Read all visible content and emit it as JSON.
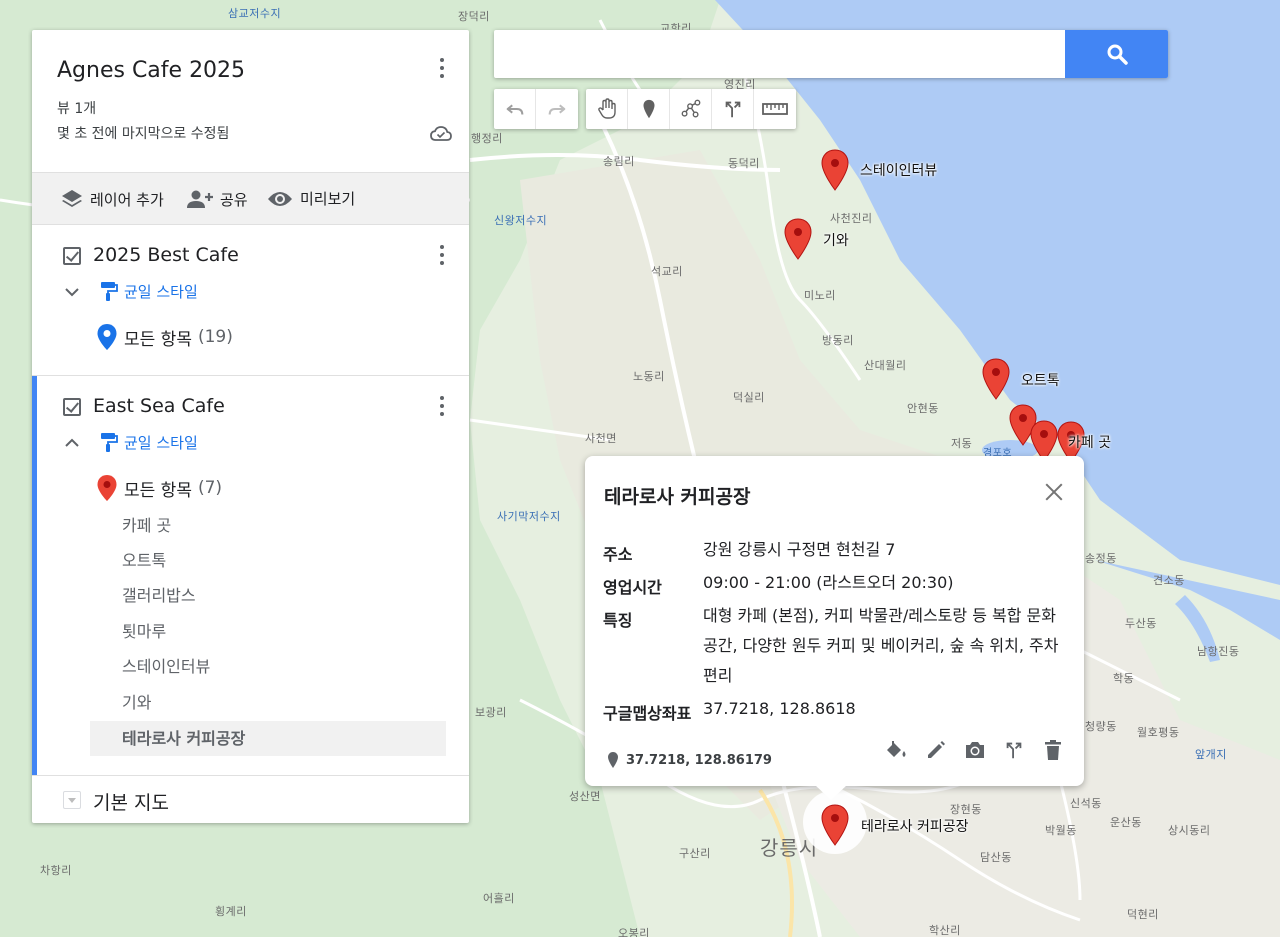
{
  "map": {
    "places": [
      {
        "id": "p1",
        "text": "삼교저수지",
        "water": true
      },
      {
        "id": "p2",
        "text": "장덕리"
      },
      {
        "id": "p3",
        "text": "교항리"
      },
      {
        "id": "p4",
        "text": "영진리"
      },
      {
        "id": "p5",
        "text": "행정리"
      },
      {
        "id": "p6",
        "text": "송림리"
      },
      {
        "id": "p7",
        "text": "동덕리"
      },
      {
        "id": "p8",
        "text": "신왕저수지",
        "water": true
      },
      {
        "id": "p9",
        "text": "사천진리"
      },
      {
        "id": "p10",
        "text": "석교리"
      },
      {
        "id": "p11",
        "text": "미노리"
      },
      {
        "id": "p12",
        "text": "방동리"
      },
      {
        "id": "p13",
        "text": "산대월리"
      },
      {
        "id": "p14",
        "text": "노동리"
      },
      {
        "id": "p15",
        "text": "덕실리"
      },
      {
        "id": "p16",
        "text": "안현동"
      },
      {
        "id": "p17",
        "text": "사천면"
      },
      {
        "id": "p18",
        "text": "저동"
      },
      {
        "id": "p19",
        "text": "경포호",
        "water": true
      },
      {
        "id": "p20",
        "text": "사기막저수지",
        "water": true
      },
      {
        "id": "p21",
        "text": "송정동"
      },
      {
        "id": "p22",
        "text": "견소동"
      },
      {
        "id": "p23",
        "text": "두산동"
      },
      {
        "id": "p24",
        "text": "남항진동"
      },
      {
        "id": "p25",
        "text": "학동"
      },
      {
        "id": "p26",
        "text": "월호평동"
      },
      {
        "id": "p27",
        "text": "보광리"
      },
      {
        "id": "p28",
        "text": "청량동"
      },
      {
        "id": "p29",
        "text": "앞개지",
        "water": true
      },
      {
        "id": "p30",
        "text": "성산면"
      },
      {
        "id": "p31",
        "text": "장현동"
      },
      {
        "id": "p32",
        "text": "신석동"
      },
      {
        "id": "p33",
        "text": "운산동"
      },
      {
        "id": "p34",
        "text": "상시동리"
      },
      {
        "id": "p35",
        "text": "박월동"
      },
      {
        "id": "p36",
        "text": "구산리"
      },
      {
        "id": "p37",
        "text": "담산동"
      },
      {
        "id": "p38",
        "text": "강릉시",
        "big": true
      },
      {
        "id": "p39",
        "text": "차항리"
      },
      {
        "id": "p40",
        "text": "어흘리"
      },
      {
        "id": "p41",
        "text": "횡계리"
      },
      {
        "id": "p42",
        "text": "덕현리"
      },
      {
        "id": "p43",
        "text": "학산리"
      },
      {
        "id": "p44",
        "text": "오봉리"
      }
    ],
    "markers": [
      {
        "id": "m1",
        "label": "스테이인터뷰"
      },
      {
        "id": "m2",
        "label": "기와"
      },
      {
        "id": "m3",
        "label": "오트톡"
      },
      {
        "id": "m4",
        "label": ""
      },
      {
        "id": "m5",
        "label": ""
      },
      {
        "id": "m6",
        "label": "카페 곳"
      },
      {
        "id": "m7",
        "label": "테라로사 커피공장",
        "selected": true
      }
    ],
    "marker_color": "#ea4335"
  },
  "search": {
    "value": "",
    "placeholder": ""
  },
  "toolbar": {
    "buttons": [
      "undo-icon",
      "redo-icon",
      "hand-pan-icon",
      "add-marker-icon",
      "draw-line-icon",
      "directions-icon",
      "measure-ruler-icon"
    ]
  },
  "panel": {
    "title": "Agnes Cafe 2025",
    "views": "뷰 1개",
    "modified": "몇 초 전에 마지막으로 수정됨",
    "actions": {
      "add_layer": "레이어 추가",
      "share": "공유",
      "preview": "미리보기"
    },
    "layers": [
      {
        "name": "2025 Best Cafe",
        "style": "균일 스타일",
        "all_items": "모든 항목",
        "count": "(19)",
        "pin_color": "#1a73e8"
      },
      {
        "name": "East Sea Cafe",
        "style": "균일 스타일",
        "all_items": "모든 항목",
        "count": "(7)",
        "pin_color": "#ea4335",
        "items": [
          "카페 곳",
          "오트톡",
          "갤러리밥스",
          "툇마루",
          "스테이인터뷰",
          "기와",
          "테라로사 커피공장"
        ]
      }
    ],
    "basemap": "기본 지도"
  },
  "popup": {
    "title": "테라로사 커피공장",
    "rows": [
      {
        "key": "주소",
        "value": "강원 강릉시 구정면 현천길 7"
      },
      {
        "key": "영업시간",
        "value": "09:00 - 21:00 (라스트오더 20:30)"
      },
      {
        "key": "특징",
        "value": "대형 카페 (본점), 커피 박물관/레스토랑 등 복합 문화 공간, 다양한 원두 커피 및 베이커리, 숲 속 위치, 주차 편리"
      },
      {
        "key": "구글맵상좌표",
        "value": "37.7218, 128.8618"
      }
    ],
    "coords": "37.7218, 128.86179"
  }
}
